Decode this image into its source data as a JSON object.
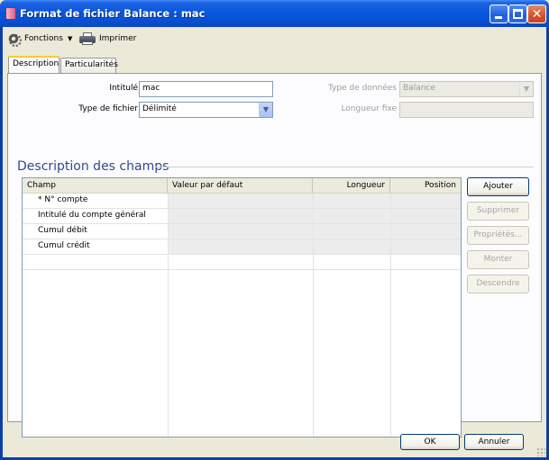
{
  "window": {
    "title": "Format de fichier Balance : mac"
  },
  "toolbar": {
    "fonctions_label": "Fonctions",
    "imprimer_label": "Imprimer"
  },
  "tabs": [
    {
      "label": "Description",
      "selected": true
    },
    {
      "label": "Particularités",
      "selected": false
    }
  ],
  "form": {
    "intitule_label": "Intitulé",
    "intitule_value": "mac",
    "type_fichier_label": "Type de fichier",
    "type_fichier_value": "Délimité",
    "type_donnees_label": "Type de données",
    "type_donnees_value": "Balance",
    "longueur_fixe_label": "Longueur fixe",
    "longueur_fixe_value": ""
  },
  "section": {
    "title": "Description des champs"
  },
  "grid": {
    "columns": [
      "Champ",
      "Valeur par défaut",
      "Longueur",
      "Position"
    ],
    "rows": [
      {
        "champ": "* N° compte",
        "valeur": "",
        "longueur": "",
        "position": ""
      },
      {
        "champ": "Intitulé du compte général",
        "valeur": "",
        "longueur": "",
        "position": ""
      },
      {
        "champ": "Cumul débit",
        "valeur": "",
        "longueur": "",
        "position": ""
      },
      {
        "champ": "Cumul crédit",
        "valeur": "",
        "longueur": "",
        "position": ""
      }
    ]
  },
  "side_buttons": {
    "ajouter": "Ajouter",
    "supprimer": "Supprimer",
    "proprietes": "Propriétés...",
    "monter": "Monter",
    "descendre": "Descendre"
  },
  "footer": {
    "ok": "OK",
    "annuler": "Annuler"
  },
  "colors": {
    "titlebar": "#0653d6",
    "section_title": "#2f4b8c",
    "tab_highlight": "#ffc73c"
  }
}
